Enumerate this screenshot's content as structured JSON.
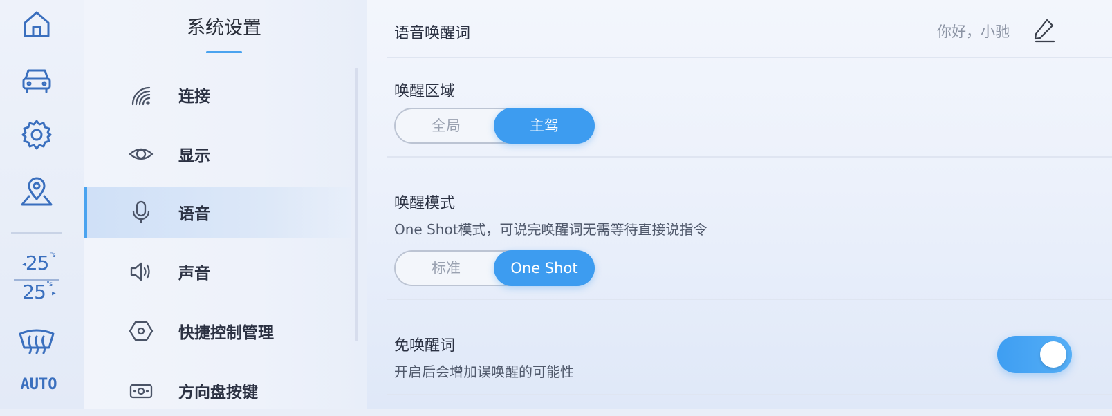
{
  "dock": {
    "icons": [
      "home-icon",
      "car-icon",
      "settings-gear-icon",
      "location-icon",
      "defrost-icon"
    ],
    "temp_left": "25",
    "temp_left_unit": "°s",
    "temp_right": "25",
    "temp_right_unit": "°s",
    "auto_label": "AUTO"
  },
  "nav": {
    "title": "系统设置",
    "items": [
      {
        "label": "连接",
        "icon": "signal-icon"
      },
      {
        "label": "显示",
        "icon": "eye-icon"
      },
      {
        "label": "语音",
        "icon": "microphone-icon",
        "active": true
      },
      {
        "label": "声音",
        "icon": "speaker-icon"
      },
      {
        "label": "快捷控制管理",
        "icon": "hexagon-icon"
      },
      {
        "label": "方向盘按键",
        "icon": "steering-button-icon"
      }
    ]
  },
  "main": {
    "wake_word": {
      "label": "语音唤醒词",
      "value": "你好，小驰",
      "edit_icon": "pencil-icon"
    },
    "wake_region": {
      "label": "唤醒区域",
      "options": [
        "全局",
        "主驾"
      ],
      "selected": "主驾"
    },
    "wake_mode": {
      "label": "唤醒模式",
      "description": "One Shot模式，可说完唤醒词无需等待直接说指令",
      "options": [
        "标准",
        "One Shot"
      ],
      "selected": "One Shot"
    },
    "free_wake": {
      "label": "免唤醒词",
      "description": "开启后会增加误唤醒的可能性",
      "enabled": true
    }
  },
  "colors": {
    "accent": "#3d9cf0",
    "icon_blue": "#3a6fbe",
    "active_bg": "#cfe0f7"
  }
}
